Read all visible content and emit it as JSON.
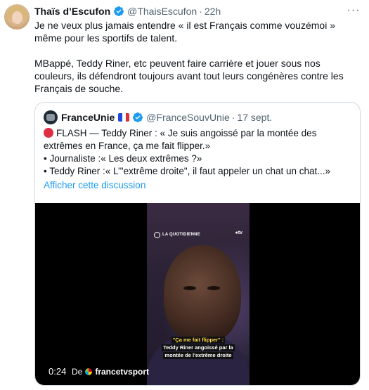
{
  "author": {
    "display_name": "Thaïs d’Escufon",
    "handle": "@ThaisEscufon",
    "separator": "·",
    "time": "22h"
  },
  "more_label": "···",
  "tweet": {
    "paragraph_1": "Je ne veux plus jamais entendre « il est Français comme vouzémoi » même pour les sportifs de talent.",
    "paragraph_2": "MBappé, Teddy Riner, etc peuvent faire carrière et jouer sous nos couleurs, ils défendront toujours avant tout leurs congénères contre les Français de souche."
  },
  "quote": {
    "display_name": "FranceUnie",
    "handle": "@FranceSouvUnie",
    "separator": "·",
    "date": "17 sept.",
    "line_1": "FLASH — Teddy Riner : « Je suis angoissé par la montée des extrêmes en France, ça me fait flipper.»",
    "line_2": "• Journaliste :« Les deux extrêmes ?»",
    "line_3": "• Teddy Riner :« L’\"extrême droite\", il faut appeler un chat un chat...»",
    "show_thread": "Afficher cette discussion"
  },
  "video": {
    "channel_logo_text": "LA QUOTIDIENNE",
    "tv_logo_text": "●tv",
    "caption_1": "\"Ça me fait flipper\" :",
    "caption_2": "Teddy Riner angoissé par la",
    "caption_3": "montée de l'extrême droite",
    "time": "0:24",
    "from_label": "De",
    "source": "francetvsport"
  },
  "colors": {
    "accent": "#1d9bf0",
    "text": "#0f1419",
    "secondary": "#536471",
    "border": "#cfd9de"
  }
}
